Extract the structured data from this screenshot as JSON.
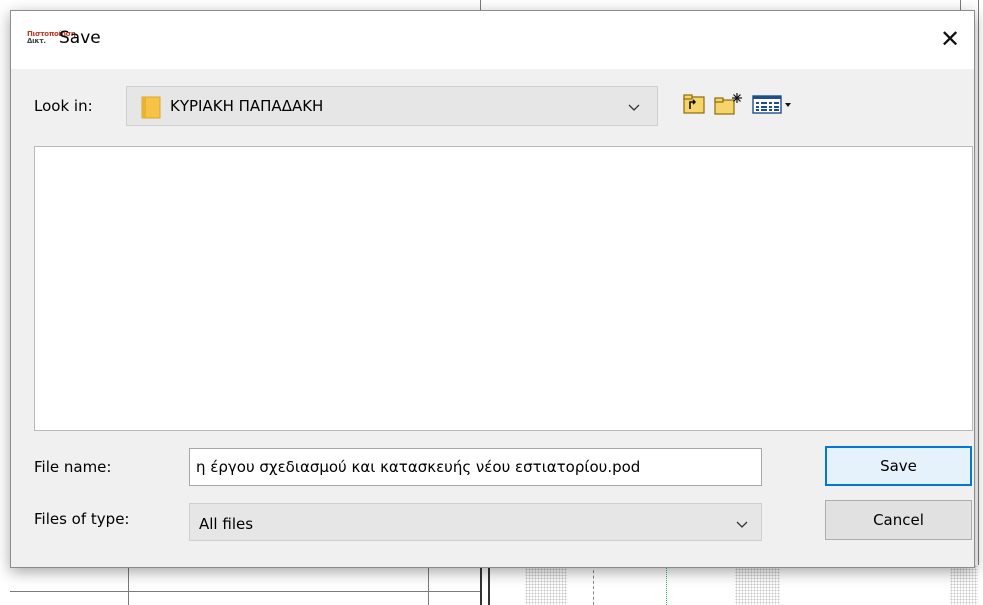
{
  "dialog": {
    "app_icon_text": "Πιστοποίηση",
    "app_icon_sub": "Δικτ.",
    "title": "Save",
    "close_glyph": "✕"
  },
  "look_in": {
    "label": "Look in:",
    "value": "ΚΥΡΙΑΚΗ ΠΑΠΑΔΑΚΗ"
  },
  "toolbar": {
    "up_icon": "up-folder-icon",
    "new_folder_icon": "new-folder-icon",
    "view_menu_icon": "view-menu-icon"
  },
  "file_list": {
    "items": []
  },
  "file_name": {
    "label": "File name:",
    "value": "η έργου σχεδιασμού και κατασκευής νέου εστιατορίου.pod"
  },
  "file_type": {
    "label": "Files of type:",
    "value": "All files"
  },
  "buttons": {
    "save": "Save",
    "cancel": "Cancel"
  },
  "colors": {
    "accent": "#0078d7",
    "folder": "#f6c344",
    "dialog_bg": "#f0f0f0"
  }
}
